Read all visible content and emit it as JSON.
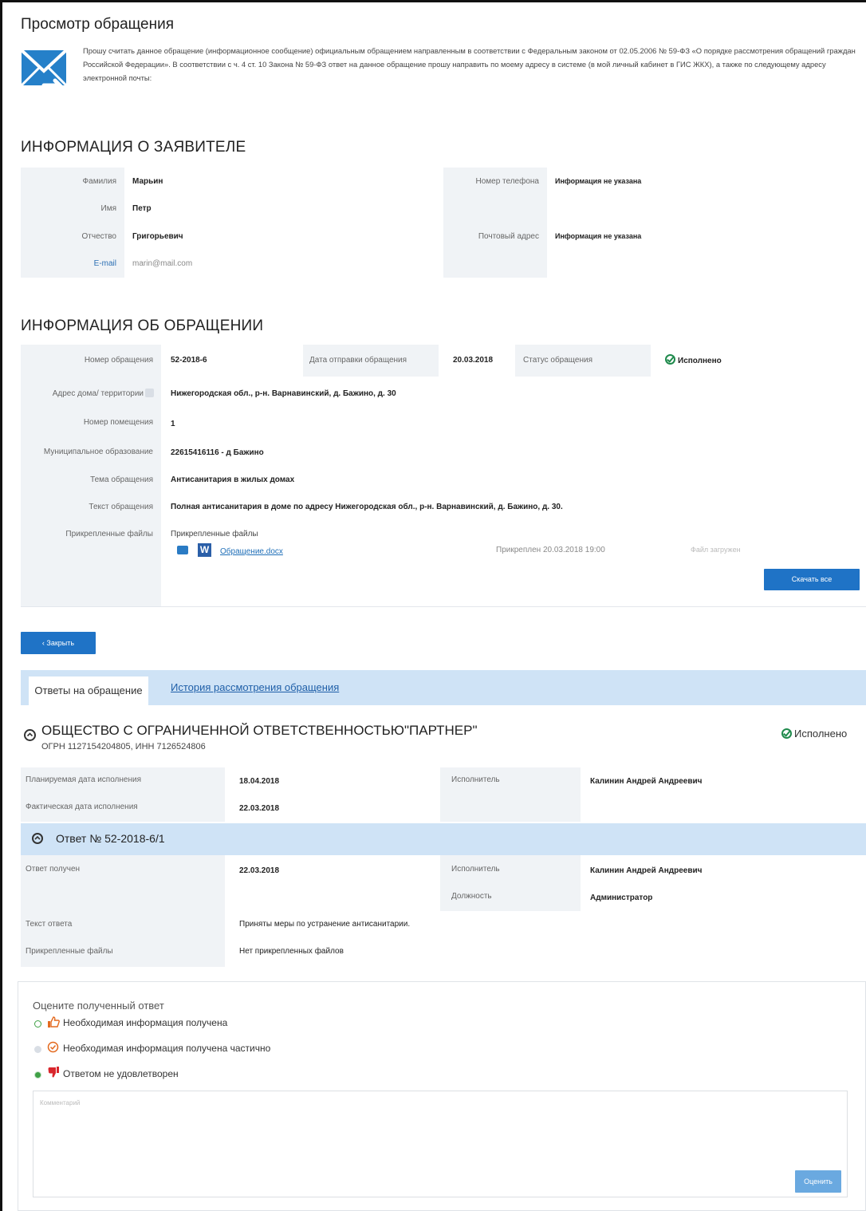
{
  "page": {
    "title": "Просмотр обращения",
    "intro": "Прошу считать данное обращение (информационное сообщение) официальным обращением  направленным в соответствии с Федеральным законом от 02.05.2006 № 59-ФЗ «О порядке рассмотрения обращений граждан Российской Федерации». В соответствии с ч. 4 ст. 10 Закона № 59-ФЗ ответ на данное обращение прошу направить по моему адресу в системе (в мой личный кабинет в ГИС ЖКХ), а также по следующему адресу электронной почты:"
  },
  "applicant": {
    "heading": "ИНФОРМАЦИЯ О ЗАЯВИТЕЛЕ",
    "last_name_label": "Фамилия",
    "last_name": "Марьин",
    "first_name_label": "Имя",
    "first_name": "Петр",
    "patronymic_label": "Отчество",
    "patronymic": "Григорьевич",
    "email_label": "E-mail",
    "email": "marin@mail.com",
    "phone_label": "Номер телефона",
    "phone": "Информация не указана",
    "postal_label": "Почтовый адрес",
    "postal": "Информация не указана"
  },
  "appeal": {
    "heading": "ИНФОРМАЦИЯ ОБ ОБРАЩЕНИИ",
    "number_label": "Номер обращения",
    "number": "52-2018-6",
    "sent_label": "Дата отправки обращения",
    "sent": "20.03.2018",
    "status_label": "Статус обращения",
    "status": "Исполнено",
    "address_label": "Адрес дома/ территории",
    "address": "Нижегородская обл., р-н. Варнавинский, д. Бажино, д. 30",
    "room_label": "Номер помещения",
    "room": "1",
    "municipality_label": "Муниципальное образование",
    "municipality": "22615416116 - д Бажино",
    "topic_label": "Тема обращения",
    "topic": "Антисанитария в жилых домах",
    "text_label": "Текст обращения",
    "text": "Полная антисанитария в доме по адресу Нижегородская обл., р-н. Варнавинский, д. Бажино, д. 30.",
    "files_label": "Прикрепленные файлы",
    "files_header": "Прикрепленные файлы",
    "file_name": "Обращение.docx",
    "file_attached": "Прикреплен 20.03.2018  19:00",
    "file_status": "Файл загружен",
    "download_all": "Скачать все"
  },
  "back_button": "Закрыть",
  "tabs": {
    "active": "Ответы на обращение",
    "history": "История рассмотрения обращения"
  },
  "organization": {
    "name": "ОБЩЕСТВО С ОГРАНИЧЕННОЙ ОТВЕТСТВЕННОСТЬЮ\"ПАРТНЕР\"",
    "ids": "ОГРН 1127154204805, ИНН 7126524806",
    "status": "Исполнено",
    "planned_label": "Планируемая дата исполнения",
    "planned": "18.04.2018",
    "actual_label": "Фактическая дата исполнения",
    "actual": "22.03.2018",
    "executor_label": "Исполнитель",
    "executor": "Калинин Андрей Андреевич"
  },
  "answer": {
    "title": "Ответ № 52-2018-6/1",
    "received_label": "Ответ получен",
    "received": "22.03.2018",
    "executor_label": "Исполнитель",
    "executor": "Калинин Андрей Андреевич",
    "position_label": "Должность",
    "position": "Администратор",
    "text_label": "Текст ответа",
    "text": "Приняты меры по устранение антисанитарии.",
    "files_label": "Прикрепленные файлы",
    "files": "Нет прикрепленных файлов"
  },
  "rating": {
    "title": "Оцените полученный ответ",
    "option1": "Необходимая информация получена",
    "option2": "Необходимая информация получена частично",
    "option3": "Ответом не удовлетворен",
    "placeholder": "Комментарий",
    "submit": "Оценить"
  },
  "colors": {
    "accent": "#1f73c6",
    "tab_bar": "#cfe3f6",
    "success": "#1f8a4c"
  }
}
